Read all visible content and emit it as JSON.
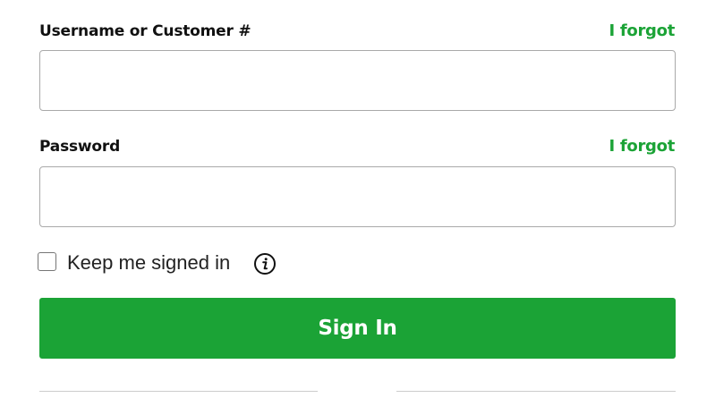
{
  "login_form": {
    "username": {
      "label": "Username or Customer #",
      "forgot_link": "I forgot",
      "value": "",
      "placeholder": ""
    },
    "password": {
      "label": "Password",
      "forgot_link": "I forgot",
      "value": "",
      "placeholder": ""
    },
    "keep_signed_in": {
      "label": "Keep me signed in",
      "checked": false,
      "info_icon": "info-icon"
    },
    "submit_label": "Sign In"
  },
  "colors": {
    "brand_green": "#1ba336",
    "input_border": "#a9a9a9",
    "text": "#111111"
  }
}
